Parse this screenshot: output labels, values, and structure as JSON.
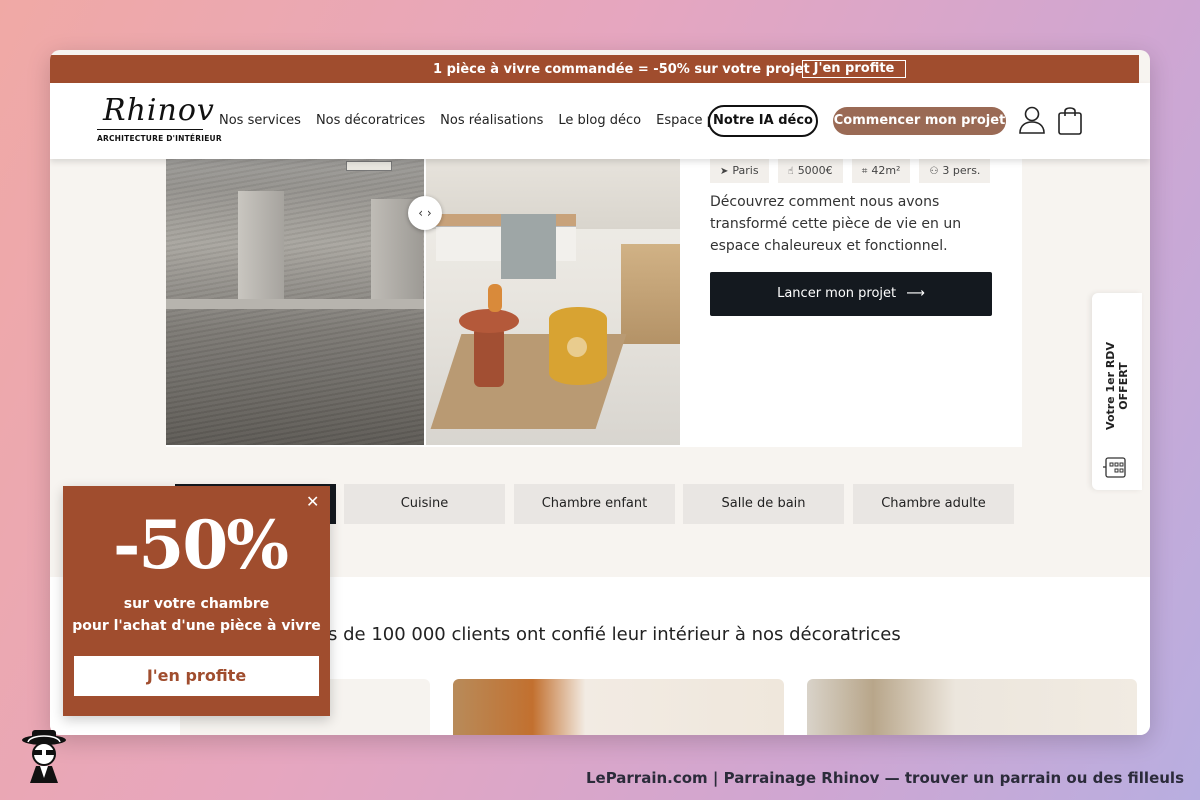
{
  "promo_bar": {
    "text": "1 pièce à vivre commandée = -50% sur votre projet",
    "button": "J'en profite"
  },
  "header": {
    "logo_word": "Rhinov",
    "logo_sub": "ARCHITECTURE D'INTÉRIEUR",
    "nav": [
      "Nos services",
      "Nos décoratrices",
      "Nos réalisations",
      "Le blog déco",
      "Espace pro"
    ],
    "ia_button": "Notre IA déco",
    "start_button": "Commencer mon projet"
  },
  "project_card": {
    "tags": [
      {
        "icon": "location-icon",
        "label": "Paris"
      },
      {
        "icon": "hand-icon",
        "label": "5000€"
      },
      {
        "icon": "area-icon",
        "label": "42m²"
      },
      {
        "icon": "people-icon",
        "label": "3 pers."
      }
    ],
    "description": "Découvrez comment nous avons transformé cette pièce de vie en un espace chaleureux et fonctionnel.",
    "launch_button": "Lancer mon projet",
    "slider_arrows": "‹ ›"
  },
  "side_tab": {
    "line1": "Votre 1er RDV",
    "line2": "OFFERT"
  },
  "rooms": [
    "Cuisine",
    "Chambre enfant",
    "Salle de bain",
    "Chambre adulte"
  ],
  "lower": {
    "clients_text": "s de 100 000 clients ont confié leur intérieur à nos décoratrices"
  },
  "popup": {
    "big": "-50%",
    "line1": "sur votre chambre",
    "line2": "pour l'achat d'une pièce à vivre",
    "button": "J'en profite",
    "close": "✕"
  },
  "footer_caption": "LeParrain.com | Parrainage Rhinov — trouver un parrain ou des filleuls",
  "colors": {
    "brand": "#a04d2e",
    "start_button": "#9a6a55",
    "dark": "#14191f"
  }
}
